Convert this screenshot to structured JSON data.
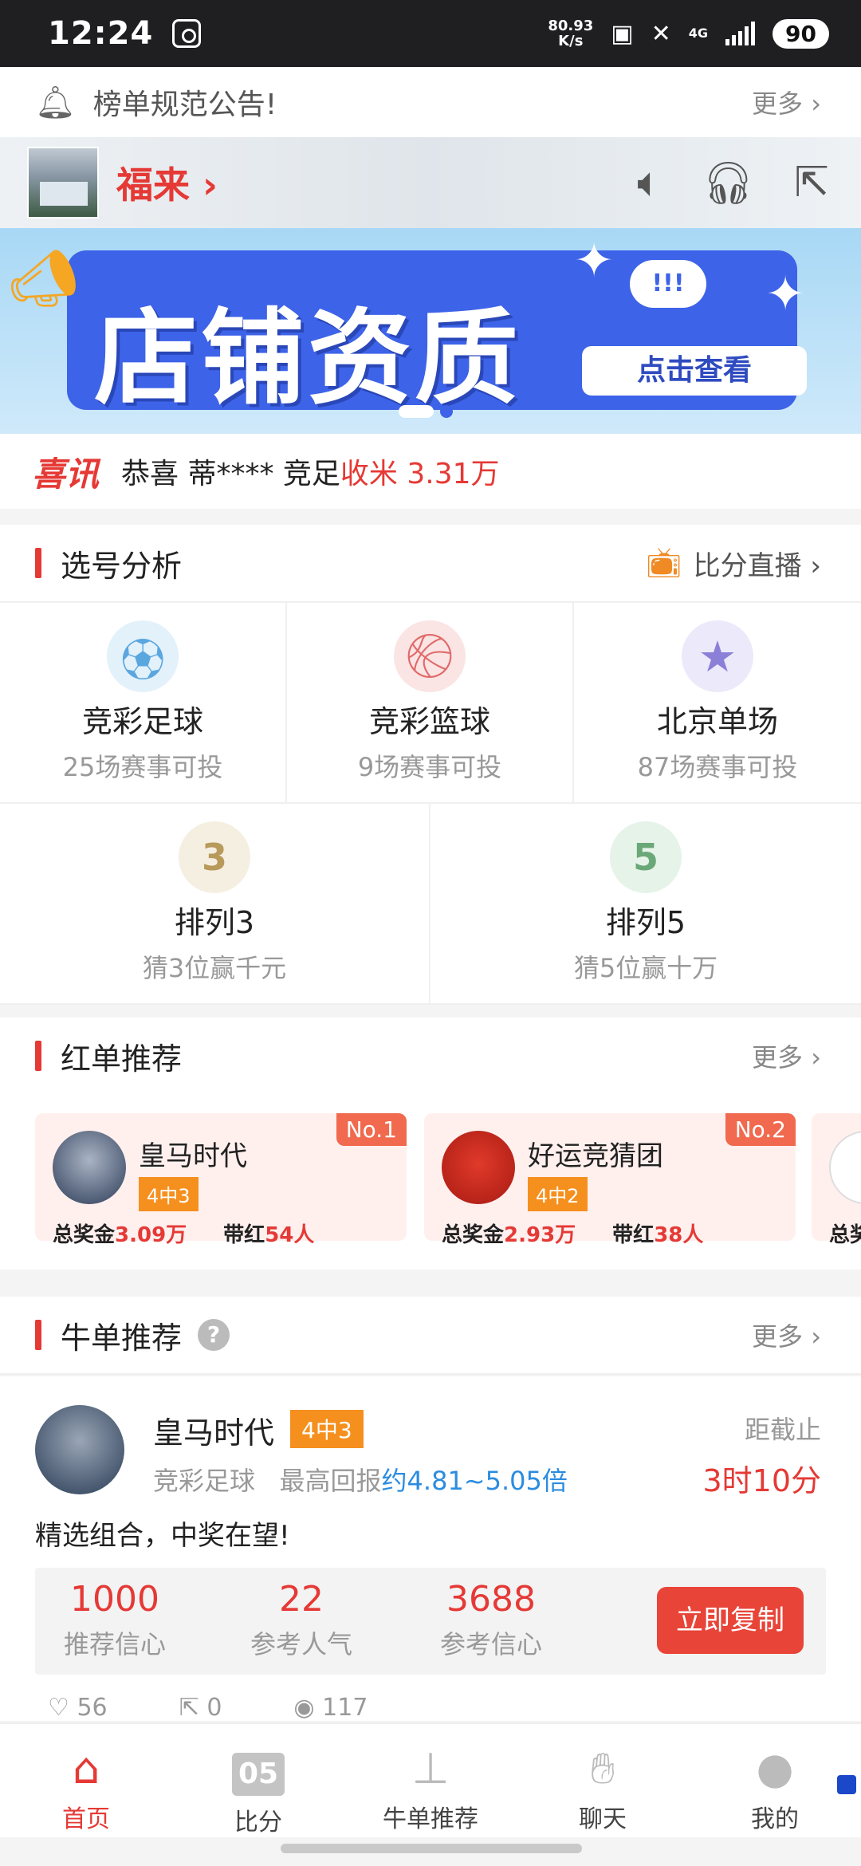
{
  "status_bar": {
    "time": "12:24",
    "speed_value": "80.93",
    "speed_unit": "K/s",
    "network": "4G",
    "battery": "90"
  },
  "notice": {
    "text": "榜单规范公告!",
    "more": "更多 ›"
  },
  "store": {
    "name": "福来 ›",
    "icons": [
      "speaker-icon",
      "headset-icon",
      "share-icon"
    ]
  },
  "banner": {
    "title": "店铺资质",
    "cta": "点击查看",
    "bubble": "!!!"
  },
  "ticker": {
    "logo": "喜讯",
    "prefix": "恭喜 蒂****  竞足",
    "amount": "收米 3.31万"
  },
  "analysis": {
    "title": "选号分析",
    "live_label": "比分直播 ›",
    "games": [
      {
        "name": "竞彩足球",
        "sub": "25场赛事可投",
        "icon": "soccer-icon",
        "color": "#5aa7e0"
      },
      {
        "name": "竞彩篮球",
        "sub": "9场赛事可投",
        "icon": "basketball-icon",
        "color": "#e06a6a"
      },
      {
        "name": "北京单场",
        "sub": "87场赛事可投",
        "icon": "star-icon",
        "color": "#8b7fd8"
      },
      {
        "name": "排列3",
        "sub": "猜3位赢千元",
        "icon": "pailie3-icon",
        "color": "#b89a5a"
      },
      {
        "name": "排列5",
        "sub": "猜5位赢十万",
        "icon": "pailie5-icon",
        "color": "#6aa878"
      }
    ]
  },
  "red": {
    "title": "红单推荐",
    "more": "更多 ›",
    "cards": [
      {
        "rank": "No.1",
        "name": "皇马时代",
        "tag": "4中3",
        "prize_label": "总奖金",
        "prize": "3.09万",
        "red_label": "带红",
        "red_count": "54人"
      },
      {
        "rank": "No.2",
        "name": "好运竞猜团",
        "tag": "4中2",
        "prize_label": "总奖金",
        "prize": "2.93万",
        "red_label": "带红",
        "red_count": "38人"
      },
      {
        "rank": "",
        "name": "",
        "tag": "",
        "prize_label": "总奖",
        "prize": "",
        "red_label": "",
        "red_count": ""
      }
    ]
  },
  "niu": {
    "title": "牛单推荐",
    "help": "?",
    "more": "更多 ›",
    "author": "皇马时代",
    "tag": "4中3",
    "sport": "竞彩足球",
    "return_label": "最高回报",
    "return_value": "约4.81~5.05倍",
    "deadline_label": "距截止",
    "deadline": "3时10分",
    "desc": "精选组合，中奖在望!",
    "stats": [
      {
        "value": "1000",
        "label": "推荐信心"
      },
      {
        "value": "22",
        "label": "参考人气"
      },
      {
        "value": "3688",
        "label": "参考信心"
      }
    ],
    "copy": "立即复制",
    "likes": "56",
    "shares": "0",
    "views": "117"
  },
  "tabbar": {
    "items": [
      {
        "label": "首页",
        "icon": "home-icon"
      },
      {
        "label": "比分",
        "icon": "scoreboard-icon"
      },
      {
        "label": "牛单推荐",
        "icon": "stamp-icon"
      },
      {
        "label": "聊天",
        "icon": "handshake-icon"
      },
      {
        "label": "我的",
        "icon": "user-icon"
      }
    ],
    "scoreboard_text": "05"
  }
}
